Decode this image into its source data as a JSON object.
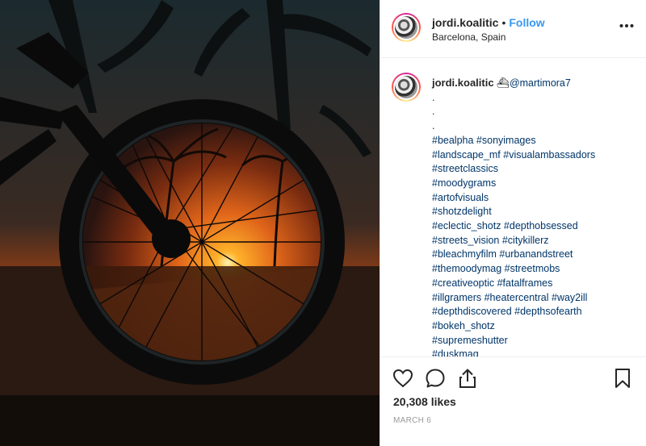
{
  "header": {
    "username": "jordi.koalitic",
    "separator": "•",
    "follow_label": "Follow",
    "location": "Barcelona, Spain",
    "more_label": "•••"
  },
  "caption": {
    "username": "jordi.koalitic",
    "emoji": "⛴",
    "mention": "@martimora7",
    "dots": [
      ".",
      ".",
      "."
    ],
    "hashtag_lines": [
      "#bealpha #sonyimages",
      "#landscape_mf #visualambassadors",
      "#streetclassics",
      "#moodygrams",
      "#artofvisuals",
      "#shotzdelight",
      "#eclectic_shotz #depthobsessed",
      "#streets_vision #citykillerz",
      "#bleachmyfilm #urbanandstreet",
      "#themoodymag #streetmobs",
      "#creativeoptic #fatalframes",
      "#illgramers #heatercentral #way2ill",
      "#depthdiscovered #depthsofearth",
      "#bokeh_shotz",
      "#supremeshutter",
      "#duskmag"
    ]
  },
  "actions": {
    "like_icon": "heart-icon",
    "comment_icon": "comment-icon",
    "share_icon": "share-icon",
    "save_icon": "bookmark-icon"
  },
  "likes": "20,308 likes",
  "date": "MARCH 6",
  "colors": {
    "link": "#003569",
    "follow": "#3897f0",
    "muted": "#999999"
  }
}
